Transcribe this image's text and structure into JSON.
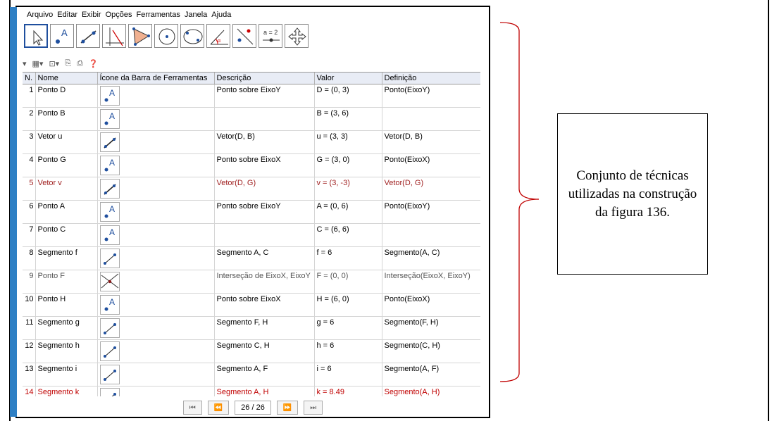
{
  "menu": [
    "Arquivo",
    "Editar",
    "Exibir",
    "Opções",
    "Ferramentas",
    "Janela",
    "Ajuda"
  ],
  "toolbar": {
    "tools": [
      "move-tool",
      "point-tool",
      "line-tool",
      "perpendicular-tool",
      "polygon-tool",
      "circle-tool",
      "conic-tool",
      "angle-tool",
      "reflect-tool",
      "slider-tool",
      "move-graphics-tool"
    ],
    "slider_label": "a = 2"
  },
  "table": {
    "headers": [
      "N.",
      "Nome",
      "Ícone da Barra de Ferramentas",
      "Descrição",
      "Valor",
      "Definição"
    ],
    "rows": [
      {
        "n": "1",
        "nome": "Ponto D",
        "icon": "point",
        "desc": "Ponto sobre EixoY",
        "valor": "D = (0, 3)",
        "def": "Ponto(EixoY)",
        "style": ""
      },
      {
        "n": "2",
        "nome": "Ponto B",
        "icon": "point",
        "desc": "",
        "valor": "B = (3, 6)",
        "def": "",
        "style": ""
      },
      {
        "n": "3",
        "nome": "Vetor u",
        "icon": "vector",
        "desc": "Vetor(D, B)",
        "valor": "u = (3, 3)",
        "def": "Vetor(D, B)",
        "style": ""
      },
      {
        "n": "4",
        "nome": "Ponto G",
        "icon": "point",
        "desc": "Ponto sobre EixoX",
        "valor": "G = (3, 0)",
        "def": "Ponto(EixoX)",
        "style": ""
      },
      {
        "n": "5",
        "nome": "Vetor v",
        "icon": "vector",
        "desc": "Vetor(D, G)",
        "valor": "v = (3, -3)",
        "def": "Vetor(D, G)",
        "style": "red-dark"
      },
      {
        "n": "6",
        "nome": "Ponto A",
        "icon": "point",
        "desc": "Ponto sobre EixoY",
        "valor": "A = (0, 6)",
        "def": "Ponto(EixoY)",
        "style": ""
      },
      {
        "n": "7",
        "nome": "Ponto C",
        "icon": "point",
        "desc": "",
        "valor": "C = (6, 6)",
        "def": "",
        "style": ""
      },
      {
        "n": "8",
        "nome": "Segmento f",
        "icon": "segment",
        "desc": "Segmento A, C",
        "valor": "f = 6",
        "def": "Segmento(A, C)",
        "style": ""
      },
      {
        "n": "9",
        "nome": "Ponto F",
        "icon": "intersect",
        "desc": "Interseção de EixoX, EixoY",
        "valor": "F = (0, 0)",
        "def": "Interseção(EixoX, EixoY)",
        "style": "gray"
      },
      {
        "n": "10",
        "nome": "Ponto H",
        "icon": "point",
        "desc": "Ponto sobre EixoX",
        "valor": "H = (6, 0)",
        "def": "Ponto(EixoX)",
        "style": ""
      },
      {
        "n": "11",
        "nome": "Segmento g",
        "icon": "segment",
        "desc": "Segmento F, H",
        "valor": "g = 6",
        "def": "Segmento(F, H)",
        "style": ""
      },
      {
        "n": "12",
        "nome": "Segmento h",
        "icon": "segment",
        "desc": "Segmento C, H",
        "valor": "h = 6",
        "def": "Segmento(C, H)",
        "style": ""
      },
      {
        "n": "13",
        "nome": "Segmento i",
        "icon": "segment",
        "desc": "Segmento A, F",
        "valor": "i = 6",
        "def": "Segmento(A, F)",
        "style": ""
      },
      {
        "n": "14",
        "nome": "Segmento k",
        "icon": "segment",
        "desc": "Segmento A, H",
        "valor": "k = 8.49",
        "def": "Segmento(A, H)",
        "style": "red"
      }
    ]
  },
  "nav": {
    "first": "⏮",
    "prev": "⏪",
    "page": "26 / 26",
    "next": "⏩",
    "last": "⏭"
  },
  "note": "Conjunto de técnicas utilizadas na construção da figura 136.",
  "colors": {
    "accent_blue": "#2e7fc4",
    "header_bg": "#e8ecf5",
    "red": "#c00000"
  }
}
